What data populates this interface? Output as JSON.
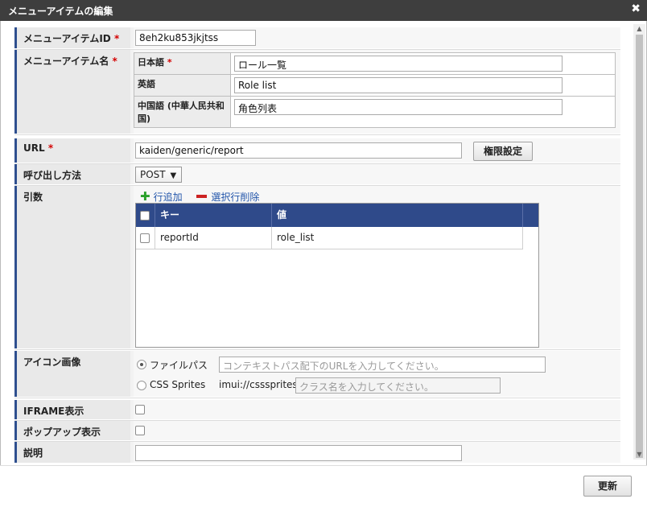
{
  "dialog": {
    "title": "メニューアイテムの編集",
    "close_glyph": "✖"
  },
  "fields": {
    "menu_item_id": {
      "label": "メニューアイテムID",
      "required": "*",
      "value": "8eh2ku853jkjtss"
    },
    "menu_item_name": {
      "label": "メニューアイテム名",
      "required": "*",
      "languages": [
        {
          "name": "日本語",
          "required": "*",
          "value": "ロール一覧"
        },
        {
          "name": "英語",
          "required": "",
          "value": "Role list"
        },
        {
          "name": "中国語 (中華人民共和国)",
          "required": "",
          "value": "角色列表"
        }
      ]
    },
    "url": {
      "label": "URL",
      "required": "*",
      "value": "kaiden/generic/report",
      "button_label": "権限設定"
    },
    "call_method": {
      "label": "呼び出し方法",
      "selected": "POST",
      "arrow": "▼"
    },
    "arguments": {
      "label": "引数",
      "add_label": "行追加",
      "delete_label": "選択行削除",
      "columns": [
        "キー",
        "値"
      ],
      "rows": [
        {
          "key": "reportId",
          "value": "role_list"
        }
      ]
    },
    "icon_image": {
      "label": "アイコン画像",
      "option_file": "ファイルパス",
      "file_placeholder": "コンテキストパス配下のURLを入力してください。",
      "option_sprites": "CSS Sprites",
      "sprites_prefix": "imui://csssprites/",
      "sprites_placeholder": "クラス名を入力してください。",
      "selected": "ファイルパス"
    },
    "iframe_display": {
      "label": "IFRAME表示",
      "checked": false
    },
    "popup_display": {
      "label": "ポップアップ表示",
      "checked": false
    },
    "description": {
      "label": "説明",
      "value": ""
    }
  },
  "footer": {
    "update_label": "更新"
  },
  "colors": {
    "title_bar": "#3e3e3e",
    "grid_header": "#2f4a8a",
    "label_accent": "#2e4f8f",
    "required": "#d40000"
  },
  "icons": {
    "add": "plus-icon",
    "delete": "minus-icon",
    "close": "close-icon"
  }
}
